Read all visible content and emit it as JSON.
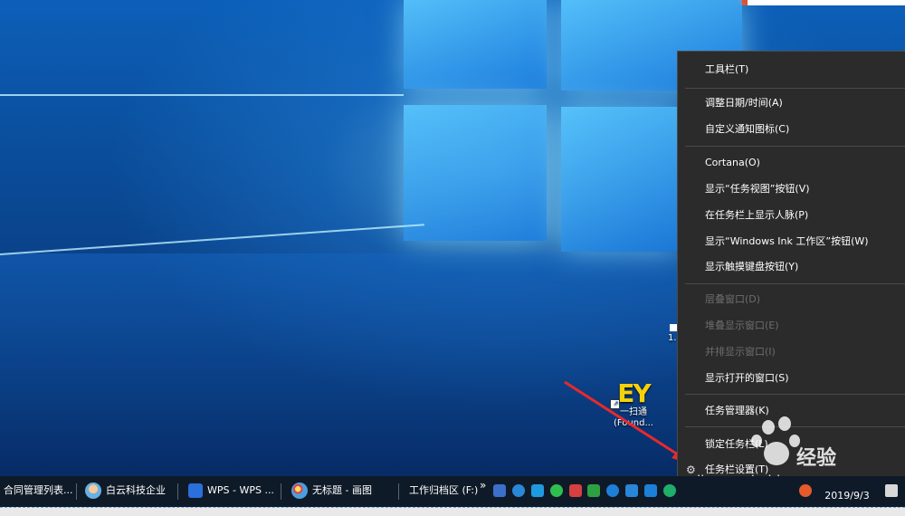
{
  "desktop": {
    "icons": [
      {
        "label": "一扫通",
        "sublabel": "(Found...",
        "name": "ey-app"
      },
      {
        "label": "1...",
        "name": "partial-icon"
      }
    ]
  },
  "context_menu": {
    "items": [
      {
        "label": "工具栏(T)",
        "enabled": true
      },
      {
        "label": "调整日期/时间(A)",
        "enabled": true
      },
      {
        "label": "自定义通知图标(C)",
        "enabled": true
      },
      {
        "label": "Cortana(O)",
        "enabled": true
      },
      {
        "label": "显示“任务视图”按钮(V)",
        "enabled": true
      },
      {
        "label": "在任务栏上显示人脉(P)",
        "enabled": true
      },
      {
        "label": "显示“Windows Ink 工作区”按钮(W)",
        "enabled": true
      },
      {
        "label": "显示触摸键盘按钮(Y)",
        "enabled": true
      },
      {
        "label": "层叠窗口(D)",
        "enabled": false
      },
      {
        "label": "堆叠显示窗口(E)",
        "enabled": false
      },
      {
        "label": "并排显示窗口(I)",
        "enabled": false
      },
      {
        "label": "显示打开的窗口(S)",
        "enabled": true
      },
      {
        "label": "任务管理器(K)",
        "enabled": true
      },
      {
        "label": "锁定任务栏(L)",
        "enabled": true
      },
      {
        "label": "任务栏设置(T)",
        "enabled": true
      }
    ]
  },
  "taskbar": {
    "tasks": [
      {
        "label": "合同管理列表...",
        "icon": "excel-icon"
      },
      {
        "label": "白云科技企业",
        "icon": "user-avatar-icon"
      },
      {
        "label": "WPS - WPS ...",
        "icon": "wps-icon"
      },
      {
        "label": "无标题 - 画图",
        "icon": "paint-icon"
      },
      {
        "label": "工作归档区 (F:)",
        "icon": "folder-icon"
      }
    ],
    "overflow": "»",
    "clock_date": "2019/9/3"
  },
  "watermark": {
    "text": "经验",
    "url": "jingyan.baidu.com"
  },
  "colors": {
    "menu_bg": "#2b2b2b",
    "taskbar_bg": "#0f1a28",
    "arrow": "#e8292b",
    "desktop_blue": "#0a4c98"
  }
}
